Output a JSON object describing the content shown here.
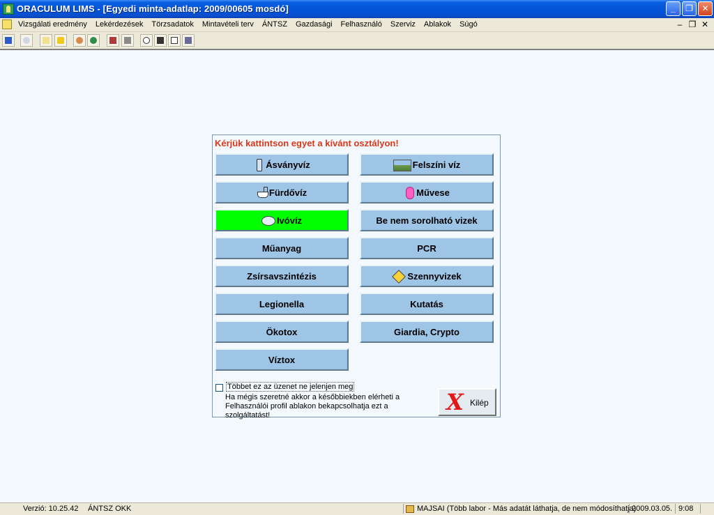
{
  "window": {
    "title": "ORACULUM LIMS - [Egyedi minta-adatlap: 2009/00605  mosdó]",
    "minimize": "_",
    "maximize": "❐",
    "close": "✕"
  },
  "menubar": {
    "items": [
      "Vizsgálati eredmény",
      "Lekérdezések",
      "Törzsadatok",
      "Mintavételi terv",
      "ÁNTSZ",
      "Gazdasági",
      "Felhasználó",
      "Szerviz",
      "Ablakok",
      "Súgó"
    ],
    "mdi_minimize": "–",
    "mdi_restore": "❐",
    "mdi_close": "✕"
  },
  "toolbar": {
    "icons": [
      "exit-icon",
      "cloud-icon",
      "calendar-icon",
      "star-icon",
      "users-icon",
      "globe-icon",
      "books-icon",
      "printer-icon",
      "clock-icon",
      "camera-icon",
      "mail-icon",
      "network-icon"
    ]
  },
  "dialog": {
    "prompt": "Kérjük kattintson egyet a kívánt osztályon!",
    "categories_left": [
      "Ásványvíz",
      "Fürdővíz",
      "Ivóvíz",
      "Műanyag",
      "Zsírsavszintézis",
      "Legionella",
      "Ökotox",
      "Víztox"
    ],
    "categories_right": [
      "Felszíni víz",
      "Művese",
      "Be nem sorolható vizek",
      "PCR",
      "Szennyvizek",
      "Kutatás",
      "Giardia, Crypto"
    ],
    "selected": "Ivóvíz",
    "selected_color": "#00ff00",
    "button_color": "#9ec4e6",
    "prompt_color": "#d9371a",
    "checkbox_label": "Többet ez az üzenet ne jelenjen meg",
    "checkbox_checked": false,
    "notice_line1": "Ha mégis szeretné akkor a későbbiekben elérheti a",
    "notice_line2": "Felhasználói profil ablakon bekapcsolhatja ezt a szolgáltatást!",
    "exit_label": "Kilép"
  },
  "statusbar": {
    "version": "Verzió: 10.25.42",
    "org": "ÁNTSZ OKK",
    "user": "MAJSAI (Több labor - Más adatát láthatja, de nem módosíthatja)",
    "date": "2009.03.05.",
    "time": "9:08"
  }
}
